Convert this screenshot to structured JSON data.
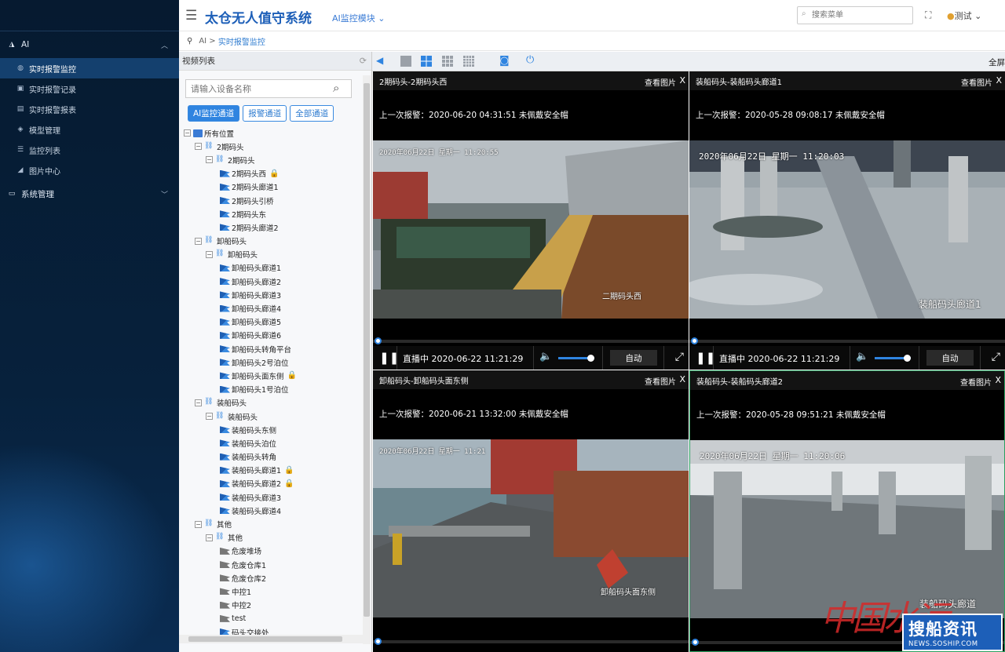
{
  "app": {
    "title": "太仓无人值守系统",
    "module": "AI监控模块 ⌄",
    "search_placeholder": "搜索菜单",
    "user": "测试 ⌄"
  },
  "sidebar": {
    "groups": [
      {
        "label": "AI",
        "icon": "ai-icon",
        "expanded": true,
        "items": [
          {
            "label": "实时报警监控",
            "icon": "globe-icon",
            "active": true
          },
          {
            "label": "实时报警记录",
            "icon": "record-icon"
          },
          {
            "label": "实时报警报表",
            "icon": "report-icon"
          },
          {
            "label": "模型管理",
            "icon": "model-icon"
          },
          {
            "label": "监控列表",
            "icon": "list-icon"
          },
          {
            "label": "图片中心",
            "icon": "chart-icon"
          }
        ]
      },
      {
        "label": "系统管理",
        "icon": "system-icon",
        "expanded": false
      }
    ]
  },
  "breadcrumb": {
    "root": "AI",
    "sep": " > ",
    "current": "实时报警监控"
  },
  "tree_panel": {
    "title": "视频列表",
    "search_placeholder": "请输入设备名称",
    "tabs": [
      "AI监控通道",
      "报警通道",
      "全部通道"
    ],
    "nodes": [
      {
        "level": 0,
        "type": "root",
        "toggle": "⊟",
        "label": "所有位置"
      },
      {
        "level": 1,
        "type": "group",
        "toggle": "⊟",
        "label": "2期码头"
      },
      {
        "level": 2,
        "type": "group",
        "toggle": "⊟",
        "label": "2期码头"
      },
      {
        "level": 3,
        "type": "cam",
        "label": "2期码头西",
        "locked": true
      },
      {
        "level": 3,
        "type": "cam",
        "label": "2期码头廊道1"
      },
      {
        "level": 3,
        "type": "cam",
        "label": "2期码头引桥"
      },
      {
        "level": 3,
        "type": "cam",
        "label": "2期码头东"
      },
      {
        "level": 3,
        "type": "cam",
        "label": "2期码头廊道2"
      },
      {
        "level": 1,
        "type": "group",
        "toggle": "⊟",
        "label": "卸船码头"
      },
      {
        "level": 2,
        "type": "group",
        "toggle": "⊟",
        "label": "卸船码头"
      },
      {
        "level": 3,
        "type": "cam",
        "label": "卸船码头廊道1"
      },
      {
        "level": 3,
        "type": "cam",
        "label": "卸船码头廊道2"
      },
      {
        "level": 3,
        "type": "cam",
        "label": "卸船码头廊道3"
      },
      {
        "level": 3,
        "type": "cam",
        "label": "卸船码头廊道4"
      },
      {
        "level": 3,
        "type": "cam",
        "label": "卸船码头廊道5"
      },
      {
        "level": 3,
        "type": "cam",
        "label": "卸船码头廊道6"
      },
      {
        "level": 3,
        "type": "cam",
        "label": "卸船码头转角平台"
      },
      {
        "level": 3,
        "type": "cam",
        "label": "卸船码头2号泊位"
      },
      {
        "level": 3,
        "type": "cam",
        "label": "卸船码头面东侧",
        "locked": true
      },
      {
        "level": 3,
        "type": "cam",
        "label": "卸船码头1号泊位"
      },
      {
        "level": 1,
        "type": "group",
        "toggle": "⊟",
        "label": "装船码头"
      },
      {
        "level": 2,
        "type": "group",
        "toggle": "⊟",
        "label": "装船码头"
      },
      {
        "level": 3,
        "type": "cam",
        "label": "装船码头东侧"
      },
      {
        "level": 3,
        "type": "cam",
        "label": "装船码头泊位"
      },
      {
        "level": 3,
        "type": "cam",
        "label": "装船码头转角"
      },
      {
        "level": 3,
        "type": "cam",
        "label": "装船码头廊道1",
        "locked": true
      },
      {
        "level": 3,
        "type": "cam",
        "label": "装船码头廊道2",
        "locked": true
      },
      {
        "level": 3,
        "type": "cam",
        "label": "装船码头廊道3"
      },
      {
        "level": 3,
        "type": "cam",
        "label": "装船码头廊道4"
      },
      {
        "level": 1,
        "type": "group",
        "toggle": "⊟",
        "label": "其他"
      },
      {
        "level": 2,
        "type": "group",
        "toggle": "⊟",
        "label": "其他"
      },
      {
        "level": 3,
        "type": "cam-off",
        "label": "危废堆场"
      },
      {
        "level": 3,
        "type": "cam-off",
        "label": "危废仓库1"
      },
      {
        "level": 3,
        "type": "cam-off",
        "label": "危废仓库2"
      },
      {
        "level": 3,
        "type": "cam-off",
        "label": "中控1"
      },
      {
        "level": 3,
        "type": "cam-off",
        "label": "中控2"
      },
      {
        "level": 3,
        "type": "cam-off",
        "label": "test"
      },
      {
        "level": 3,
        "type": "cam",
        "label": "码头交接处"
      }
    ]
  },
  "toolbar": {
    "fullscreen": "全屏",
    "colors": {
      "accent": "#2f84e0"
    }
  },
  "panels": [
    {
      "title": "2期码头-2期码头西",
      "view_pic": "查看图片",
      "close": "X",
      "alarm": "上一次报警：2020-06-20 04:31:51 未佩戴安全帽",
      "timestamp": "2020年06月22日 星期一 11:20:55",
      "cam_label": "二期码头西",
      "status": "直播中 2020-06-22 11:21:29",
      "mode": "自动"
    },
    {
      "title": "装船码头-装船码头廊道1",
      "view_pic": "查看图片",
      "close": "X",
      "alarm": "上一次报警：2020-05-28 09:08:17 未佩戴安全帽",
      "timestamp": "2020年06月22日 星期一 11:20:03",
      "cam_label": "装船码头廊道1",
      "status": "直播中 2020-06-22 11:21:29",
      "mode": "自动"
    },
    {
      "title": "卸船码头-卸船码头面东侧",
      "view_pic": "查看图片",
      "close": "X",
      "alarm": "上一次报警：2020-06-21 13:32:00 未佩戴安全帽",
      "timestamp": "2020年06月22日 星期一 11:21",
      "cam_label": "卸船码头面东侧",
      "status": "",
      "mode": ""
    },
    {
      "title": "装船码头-装船码头廊道2",
      "view_pic": "查看图片",
      "close": "X",
      "alarm": "上一次报警：2020-05-28 09:51:21 未佩戴安全帽",
      "timestamp": "2020年06月22日 星期一 11:20:06",
      "cam_label": "装船码头廊道",
      "status": "",
      "mode": ""
    }
  ],
  "watermark": {
    "cn_red": "中国水运",
    "cn": "搜船资讯",
    "en": "NEWS.SOSHIP.COM"
  }
}
